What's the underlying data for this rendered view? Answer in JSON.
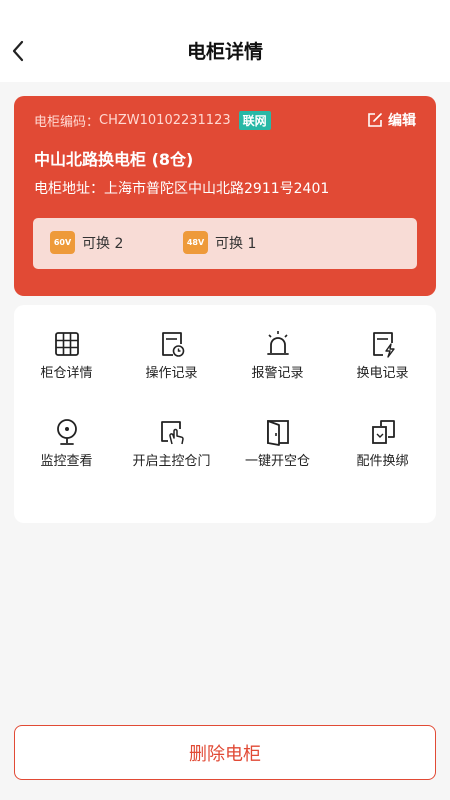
{
  "header": {
    "title": "电柜详情"
  },
  "cabinet": {
    "code_label": "电柜编码：",
    "code": "CHZW10102231123",
    "status": "联网",
    "edit_label": "编辑",
    "name": "中山北路换电柜 (8仓)",
    "address_label": "电柜地址：",
    "address": "上海市普陀区中山北路2911号2401",
    "swaps": [
      {
        "voltage": "60V",
        "label": "可换 2"
      },
      {
        "voltage": "48V",
        "label": "可换 1"
      }
    ]
  },
  "menu": [
    {
      "label": "柜仓详情",
      "icon": "grid-icon"
    },
    {
      "label": "操作记录",
      "icon": "clock-doc-icon"
    },
    {
      "label": "报警记录",
      "icon": "alarm-light-icon"
    },
    {
      "label": "换电记录",
      "icon": "bolt-doc-icon"
    },
    {
      "label": "监控查看",
      "icon": "camera-icon"
    },
    {
      "label": "开启主控仓门",
      "icon": "hand-tap-icon"
    },
    {
      "label": "一键开空仓",
      "icon": "open-door-icon"
    },
    {
      "label": "配件换绑",
      "icon": "swap-copy-icon"
    }
  ],
  "footer": {
    "delete_label": "删除电柜"
  },
  "colors": {
    "accent": "#e14a35",
    "online": "#28b8a6",
    "volt_badge": "#ee9a3a"
  }
}
